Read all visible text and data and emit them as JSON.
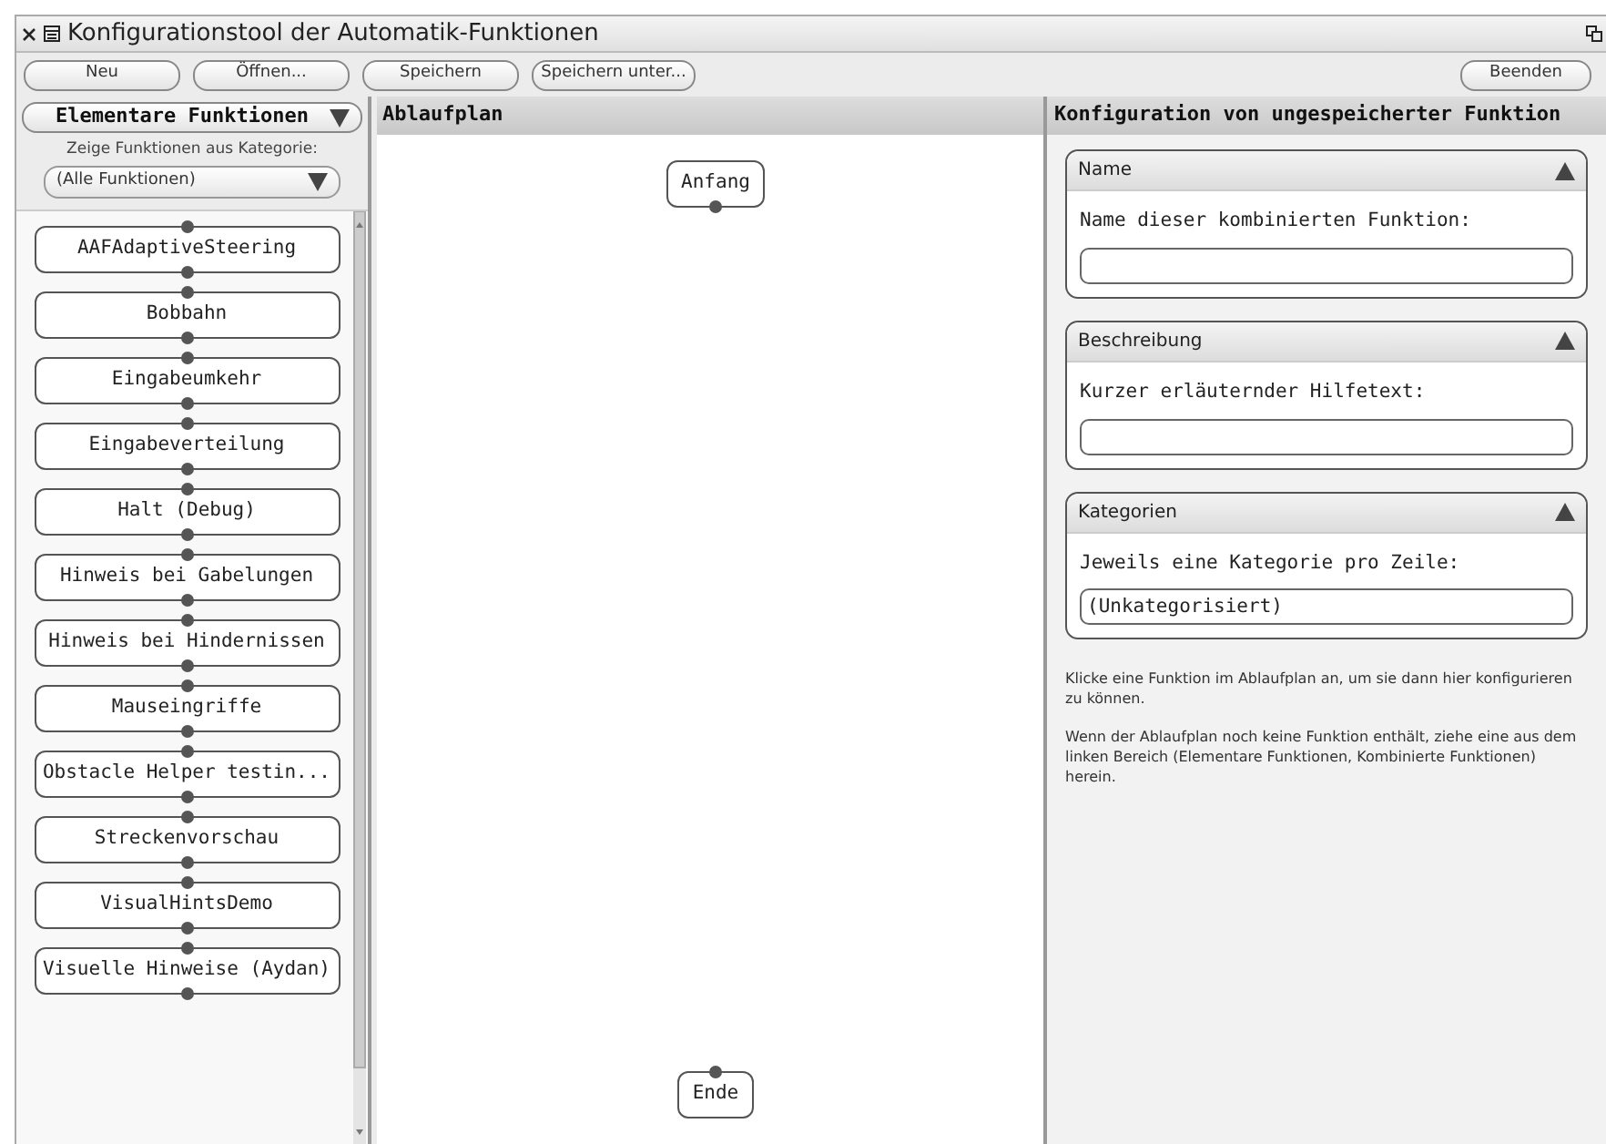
{
  "window": {
    "title": "Konfigurationstool der Automatik-Funktionen"
  },
  "toolbar": {
    "buttons": [
      "Neu",
      "Öffnen...",
      "Speichern",
      "Speichern unter..."
    ],
    "quit_button": "Beenden"
  },
  "left_panel": {
    "dropdown": "Elementare Funktionen",
    "category_label": "Zeige Funktionen aus Kategorie:",
    "category_select": "(Alle Funktionen)",
    "functions": [
      "AAFAdaptiveSteering",
      "Bobbahn",
      "Eingabeumkehr",
      "Eingabeverteilung",
      "Halt (Debug)",
      "Hinweis bei Gabelungen",
      "Hinweis bei Hindernissen",
      "Mauseingriffe",
      "Obstacle Helper testin...",
      "Streckenvorschau",
      "VisualHintsDemo",
      "Visuelle Hinweise (Aydan)"
    ]
  },
  "flowchart": {
    "title": "Ablaufplan",
    "start_node": "Anfang",
    "end_node": "Ende"
  },
  "config": {
    "title": "Konfiguration von ungespeicherter Funktion",
    "sections": [
      {
        "title": "Name",
        "expanded": true,
        "label": "Name dieser kombinierten Funktion:"
      },
      {
        "title": "Beschreibung",
        "expanded": true,
        "label": "Kurzer erläuternder Hilfetext:"
      },
      {
        "title": "Kategorien",
        "expanded": true,
        "label": "Jeweils eine Kategorie pro Zeile:",
        "value": "(Unkategorisiert)"
      }
    ],
    "hints": [
      "Klicke eine Funktion im Ablaufplan an, um sie dann hier konfigurieren zu können.",
      "Wenn der Ablaufplan noch keine Funktion enthält, ziehe eine aus dem linken Bereich (Elementare Funktionen, Kombinierte Funktionen) herein."
    ]
  }
}
